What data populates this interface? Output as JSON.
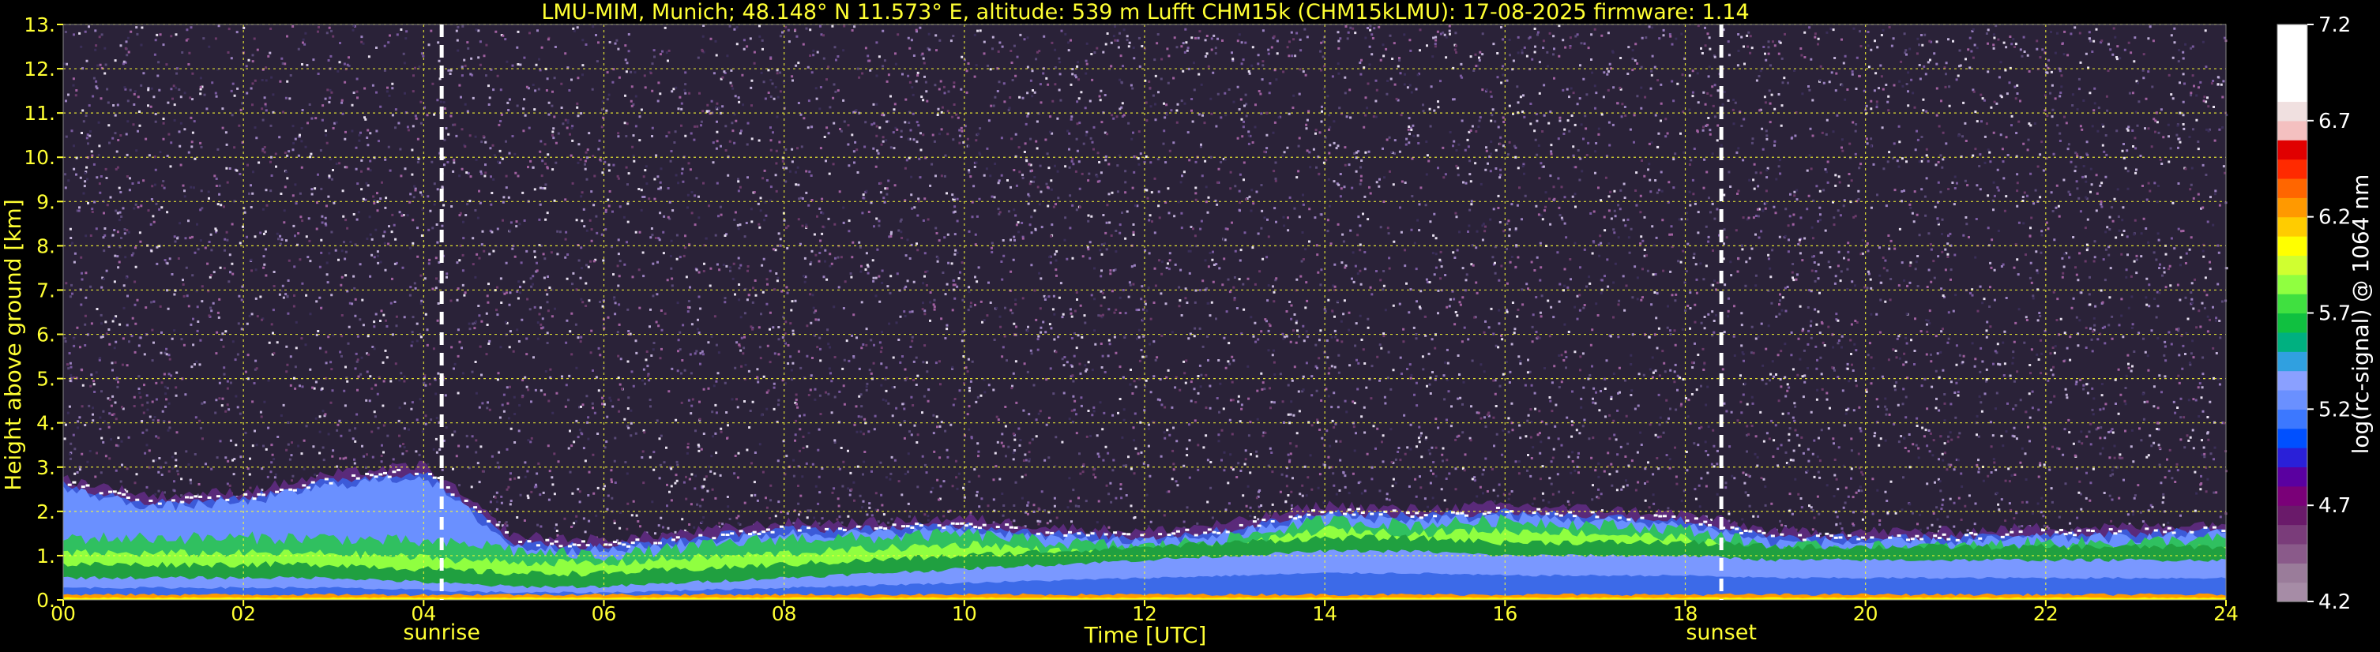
{
  "chart_data": {
    "type": "heatmap",
    "title": "LMU-MIM, Munich; 48.148° N 11.573° E, altitude: 539 m     Lufft CHM15k (CHM15kLMU): 17-08-2025     firmware: 1.14",
    "xlabel": "Time [UTC]",
    "ylabel": "Height above ground [km]",
    "xlim": [
      0,
      24
    ],
    "ylim": [
      0,
      13
    ],
    "xticks": [
      "00",
      "02",
      "04",
      "06",
      "08",
      "10",
      "12",
      "14",
      "16",
      "18",
      "20",
      "22",
      "24"
    ],
    "yticks": [
      "0.",
      "1.",
      "2.",
      "3.",
      "4.",
      "5.",
      "6.",
      "7.",
      "8.",
      "9.",
      "10.",
      "11.",
      "12.",
      "13."
    ],
    "grid": true,
    "markers": [
      {
        "label": "sunrise",
        "time": 4.2
      },
      {
        "label": "sunset",
        "time": 18.4
      }
    ],
    "colorbar": {
      "label": "log(rc-signal) @ 1064 nm",
      "range": [
        4.2,
        7.2
      ],
      "ticks": [
        "4.2",
        "4.7",
        "5.2",
        "5.7",
        "6.2",
        "6.7",
        "7.2"
      ],
      "colors": [
        "#a68ca6",
        "#9a7c9a",
        "#8a5a8a",
        "#7a3c7a",
        "#6a1a6a",
        "#7a0078",
        "#5a00a0",
        "#2a20d8",
        "#0050ff",
        "#3c78ff",
        "#6a90ff",
        "#8aa0ff",
        "#30a0e0",
        "#00b080",
        "#10c040",
        "#40e040",
        "#90ff40",
        "#d0ff30",
        "#ffff00",
        "#ffcc00",
        "#ff9900",
        "#ff6600",
        "#ff2a00",
        "#e00000",
        "#f4c0c0",
        "#f0e0e0",
        "#ffffff",
        "#ffffff",
        "#ffffff",
        "#ffffff"
      ]
    },
    "profile": {
      "hours": [
        0,
        1,
        2,
        3,
        4,
        5,
        6,
        7,
        8,
        9,
        10,
        11,
        12,
        13,
        14,
        15,
        16,
        17,
        18,
        19,
        20,
        21,
        22,
        23,
        24
      ],
      "layer_top_km": [
        2.6,
        2.2,
        2.3,
        2.7,
        2.9,
        1.3,
        1.2,
        1.4,
        1.6,
        1.6,
        1.7,
        1.5,
        1.4,
        1.6,
        2.0,
        1.9,
        2.0,
        1.9,
        1.8,
        1.4,
        1.4,
        1.4,
        1.5,
        1.5,
        1.6
      ],
      "mixed_top_km": [
        0.5,
        0.5,
        0.5,
        0.5,
        0.4,
        0.3,
        0.3,
        0.4,
        0.5,
        0.6,
        0.7,
        0.8,
        0.9,
        1.0,
        1.1,
        1.1,
        1.0,
        1.0,
        1.0,
        0.9,
        0.9,
        0.9,
        0.9,
        0.9,
        0.9
      ]
    }
  }
}
